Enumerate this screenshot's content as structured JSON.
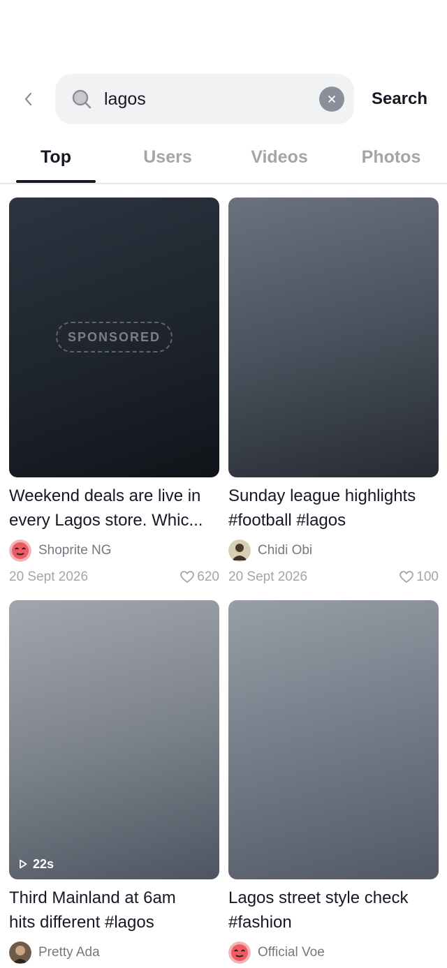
{
  "search": {
    "query": "lagos",
    "action_label": "Search"
  },
  "tabs": [
    {
      "label": "Top",
      "active": true
    },
    {
      "label": "Users",
      "active": false
    },
    {
      "label": "Videos",
      "active": false
    },
    {
      "label": "Photos",
      "active": false
    }
  ],
  "results": [
    {
      "caption_line1": "Weekend deals are live in",
      "caption_line2": "every Lagos store. Whic...",
      "author": "Shoprite NG",
      "date": "20 Sept 2026",
      "likes": "620",
      "badge": "SPONSORED"
    },
    {
      "caption_line1": "Sunday league highlights",
      "caption_line2": "#football #lagos",
      "author": "Chidi Obi",
      "date": "20 Sept 2026",
      "likes": "100"
    },
    {
      "caption_line1": "Third Mainland at 6am",
      "caption_line2": "hits different #lagos",
      "author": "Pretty Ada",
      "duration": "22s"
    },
    {
      "caption_line1": "Lagos street style check",
      "caption_line2": "#fashion",
      "author": "Official Voe"
    }
  ],
  "colors": {
    "text_primary": "#161823",
    "text_muted": "#a3a5ab",
    "search_bg": "#f1f2f3"
  },
  "icons": [
    "back-chevron-icon",
    "search-icon",
    "clear-icon",
    "heart-icon",
    "play-icon"
  ]
}
